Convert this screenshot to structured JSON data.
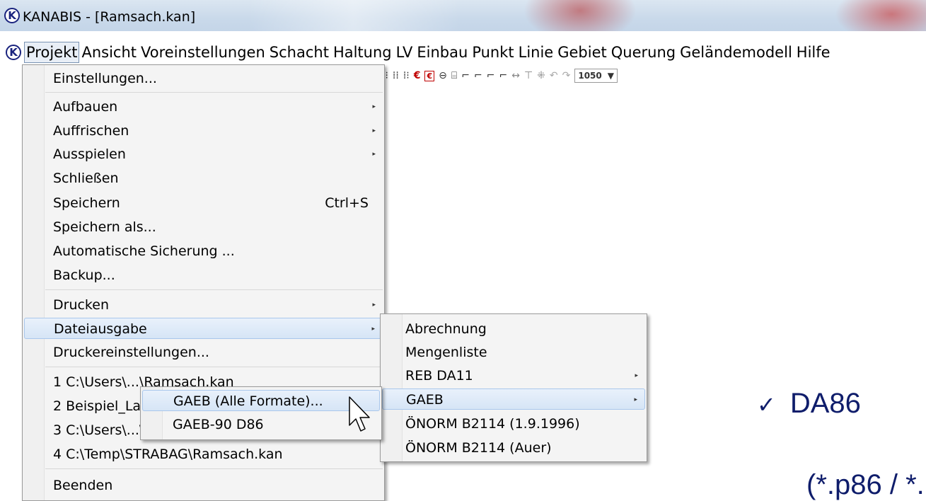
{
  "window": {
    "title": "KANABIS - [Ramsach.kan]",
    "logo_letter": "K"
  },
  "menubar": {
    "items": [
      "Projekt",
      "Ansicht",
      "Voreinstellungen",
      "Schacht",
      "Haltung",
      "LV",
      "Einbau",
      "Punkt",
      "Linie",
      "Gebiet",
      "Querung",
      "Geländemodell",
      "Hilfe"
    ],
    "active": "Projekt"
  },
  "toolbar": {
    "zoom_value": "1050",
    "euro_symbol": "€",
    "euro_box_symbol": "€"
  },
  "projekt_menu": {
    "items": {
      "einstellungen": "Einstellungen...",
      "aufbauen": "Aufbauen",
      "auffrischen": "Auffrischen",
      "ausspielen": "Ausspielen",
      "schliessen": "Schließen",
      "speichern": "Speichern",
      "speichern_shortcut": "Ctrl+S",
      "speichern_als": "Speichern als...",
      "auto_sicherung": "Automatische Sicherung ...",
      "backup": "Backup...",
      "drucken": "Drucken",
      "dateiausgabe": "Dateiausgabe",
      "druckereinstellungen": "Druckereinstellungen...",
      "recent1": "1 C:\\Users\\...\\Ramsach.kan",
      "recent2": "2 Beispiel_Lage",
      "recent3": "3 C:\\Users\\...\\Pro",
      "recent4": "4 C:\\Temp\\STRABAG\\Ramsach.kan",
      "beenden": "Beenden"
    }
  },
  "dateiausgabe_menu": {
    "items": {
      "abrechnung": "Abrechnung",
      "mengenliste": "Mengenliste",
      "reb": "REB DA11",
      "gaeb": "GAEB",
      "onorm1": "ÖNORM B2114 (1.9.1996)",
      "onorm2": "ÖNORM B2114 (Auer)"
    }
  },
  "gaeb_menu": {
    "items": {
      "alle": "GAEB (Alle Formate)...",
      "d86": "GAEB-90 D86"
    }
  },
  "slide": {
    "check_mark": "✓",
    "format": "DA86",
    "extension": "(*.p86 / *."
  },
  "colors": {
    "text_blue": "#0f1d6b",
    "highlight": "#d6e5f6"
  }
}
